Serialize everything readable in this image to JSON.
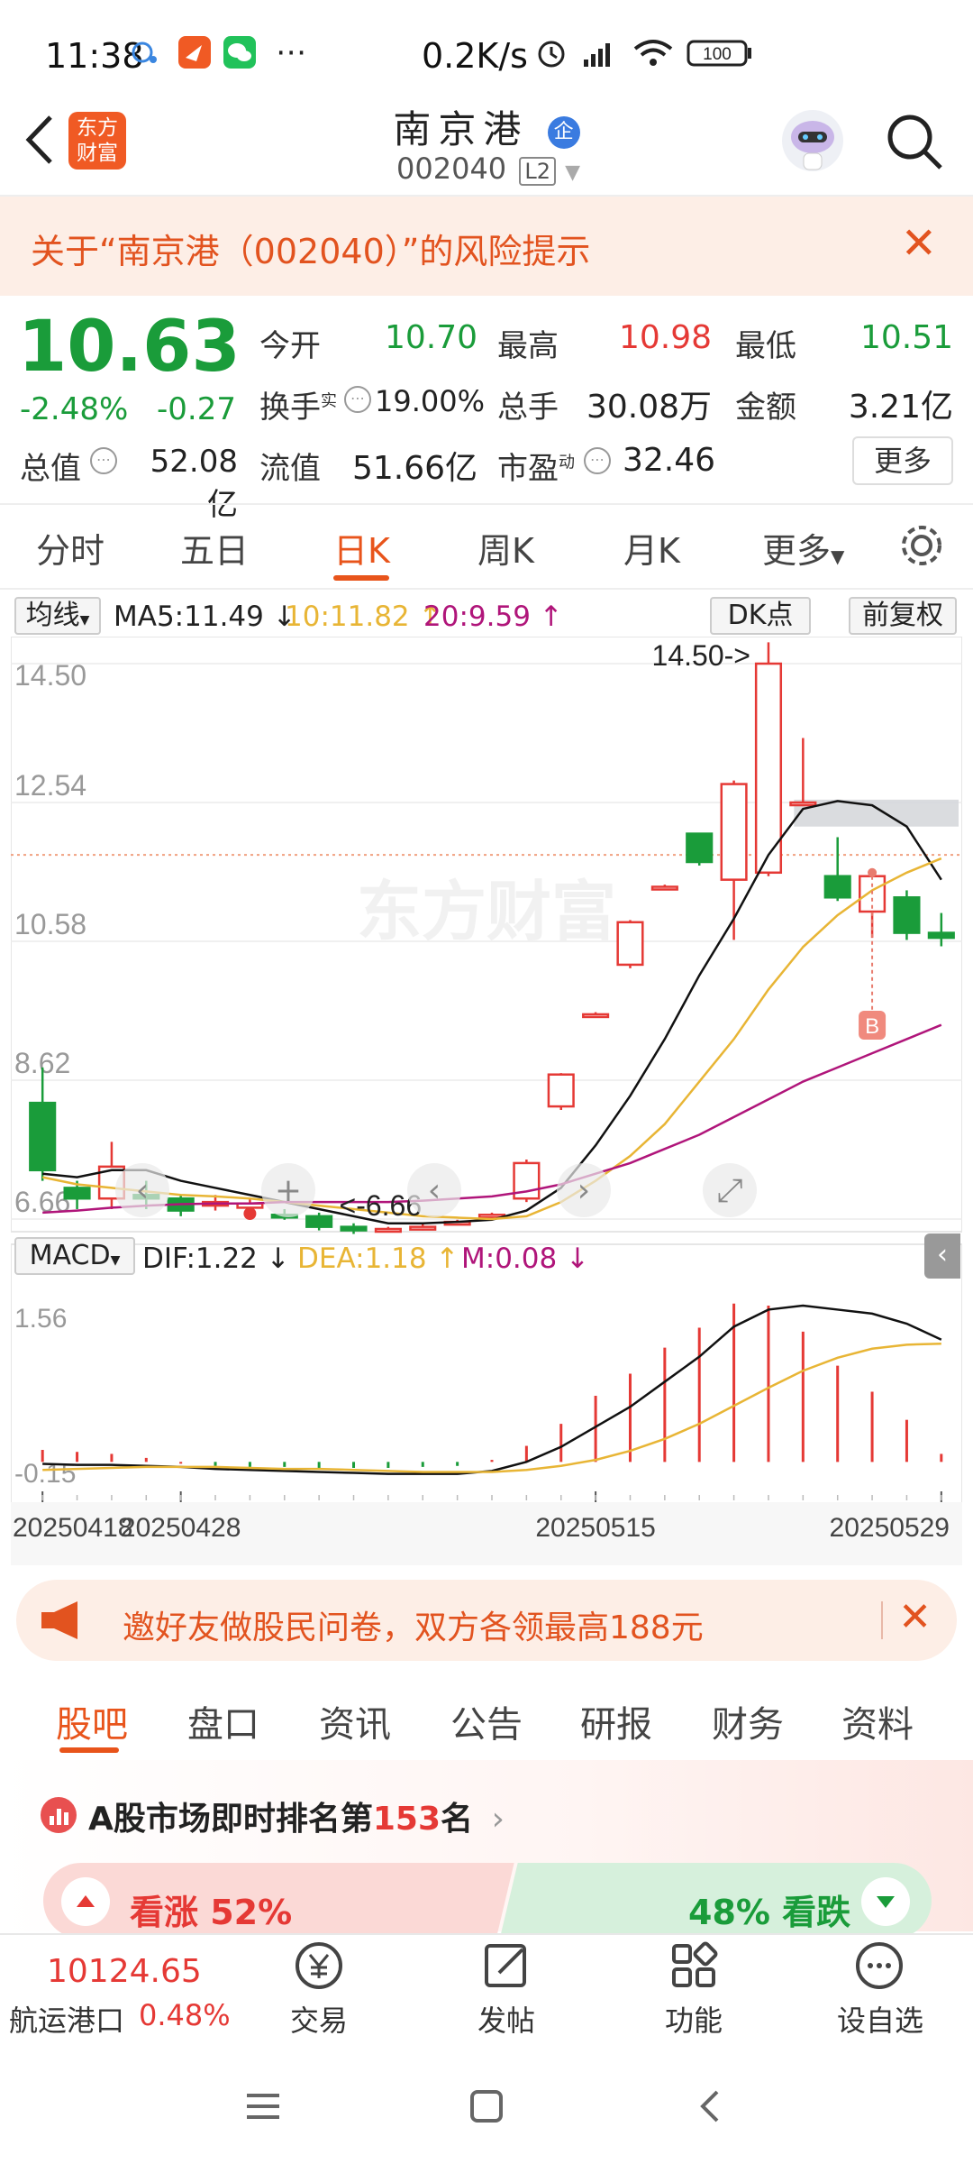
{
  "status": {
    "time": "11:38",
    "net_speed": "0.2K/s",
    "battery": "100"
  },
  "header": {
    "back_label": "<",
    "logo_text_1": "东方",
    "logo_text_2": "财富",
    "title": "南京港",
    "badge": "企",
    "code": "002040",
    "level": "L2"
  },
  "risk_banner": {
    "text": "关于“南京港（002040）”的风险提示",
    "close": "✕"
  },
  "quote": {
    "price": "10.63",
    "change_pct": "-2.48%",
    "change": "-0.27",
    "open_label": "今开",
    "open": "10.70",
    "high_label": "最高",
    "high": "10.98",
    "low_label": "最低",
    "low": "10.51",
    "turnover_label": "换手",
    "turnover_sup": "实",
    "turnover": "19.00%",
    "volume_label": "总手",
    "volume": "30.08万",
    "amount_label": "金额",
    "amount": "3.21亿",
    "mktcap_label": "总值",
    "mktcap": "52.08亿",
    "float_label": "流值",
    "float": "51.66亿",
    "pe_label": "市盈",
    "pe_sup": "动",
    "pe": "32.46",
    "more": "更多"
  },
  "tabs": [
    "分时",
    "五日",
    "日K",
    "周K",
    "月K",
    "更多"
  ],
  "indicators": {
    "ma_select": "均线",
    "ma5": "MA5:11.49",
    "ma10": "10:11.82",
    "ma20": "20:9.59",
    "dk": "DK点",
    "adjust": "前复权",
    "macd_select": "MACD",
    "dif": "DIF:1.22",
    "dea": "DEA:1.18",
    "m": "M:0.08"
  },
  "chart_data": {
    "type": "candlestick",
    "price_axis": {
      "ticks": [
        "14.50",
        "12.54",
        "10.58",
        "8.62",
        "6.66"
      ],
      "ylim": [
        6.66,
        14.5
      ]
    },
    "macd_axis": {
      "ticks": [
        "1.56",
        "-0.15"
      ],
      "ylim": [
        -0.15,
        1.56
      ]
    },
    "x_ticks": [
      "20250418",
      "20250428",
      "20250515",
      "20250529"
    ],
    "annotations": {
      "high_label": "14.50->",
      "low_label": "<-6.66",
      "buy_marker": "B"
    },
    "watermark": "东方财富",
    "candles": [
      {
        "o": 8.3,
        "c": 7.35,
        "h": 8.8,
        "l": 7.2
      },
      {
        "o": 7.1,
        "c": 6.95,
        "h": 7.2,
        "l": 6.8
      },
      {
        "o": 6.95,
        "c": 7.4,
        "h": 7.75,
        "l": 6.8
      },
      {
        "o": 7.0,
        "c": 6.95,
        "h": 7.2,
        "l": 6.8
      },
      {
        "o": 6.95,
        "c": 6.78,
        "h": 7.0,
        "l": 6.7
      },
      {
        "o": 6.85,
        "c": 6.9,
        "h": 7.0,
        "l": 6.78
      },
      {
        "o": 6.82,
        "c": 6.88,
        "h": 6.95,
        "l": 6.75
      },
      {
        "o": 6.72,
        "c": 6.7,
        "h": 6.8,
        "l": 6.65
      },
      {
        "o": 6.7,
        "c": 6.55,
        "h": 6.75,
        "l": 6.5
      },
      {
        "o": 6.55,
        "c": 6.5,
        "h": 6.6,
        "l": 6.45
      },
      {
        "o": 6.5,
        "c": 6.52,
        "h": 6.55,
        "l": 6.48
      },
      {
        "o": 6.55,
        "c": 6.55,
        "h": 6.6,
        "l": 6.5
      },
      {
        "o": 6.62,
        "c": 6.62,
        "h": 6.65,
        "l": 6.58
      },
      {
        "o": 6.7,
        "c": 6.72,
        "h": 6.75,
        "l": 6.65
      },
      {
        "o": 6.95,
        "c": 7.45,
        "h": 7.5,
        "l": 6.9
      },
      {
        "o": 8.25,
        "c": 8.7,
        "h": 8.72,
        "l": 8.2
      },
      {
        "o": 9.55,
        "c": 9.55,
        "h": 9.58,
        "l": 9.52
      },
      {
        "o": 10.25,
        "c": 10.85,
        "h": 10.88,
        "l": 10.2
      },
      {
        "o": 11.35,
        "c": 11.35,
        "h": 11.38,
        "l": 11.32
      },
      {
        "o": 12.1,
        "c": 11.7,
        "h": 12.1,
        "l": 11.65
      },
      {
        "o": 11.45,
        "c": 12.8,
        "h": 12.85,
        "l": 10.6
      },
      {
        "o": 11.55,
        "c": 14.5,
        "h": 14.8,
        "l": 11.5
      },
      {
        "o": 12.54,
        "c": 12.54,
        "h": 13.45,
        "l": 12.54
      },
      {
        "o": 11.5,
        "c": 11.2,
        "h": 12.05,
        "l": 11.15
      },
      {
        "o": 11.0,
        "c": 11.5,
        "h": 11.55,
        "l": 10.63
      },
      {
        "o": 11.2,
        "c": 10.7,
        "h": 11.3,
        "l": 10.6
      },
      {
        "o": 10.7,
        "c": 10.63,
        "h": 10.98,
        "l": 10.51
      }
    ],
    "ma_series": [
      {
        "name": "MA5",
        "color": "#111111",
        "values": [
          7.3,
          7.25,
          7.35,
          7.35,
          7.2,
          7.1,
          7.0,
          6.9,
          6.8,
          6.7,
          6.6,
          6.6,
          6.62,
          6.65,
          6.78,
          7.1,
          7.7,
          8.4,
          9.2,
          10.1,
          10.9,
          11.8,
          12.45,
          12.56,
          12.5,
          12.2,
          11.45
        ]
      },
      {
        "name": "MA10",
        "color": "#e8b535",
        "values": [
          7.25,
          7.15,
          7.1,
          7.05,
          7.0,
          6.98,
          6.95,
          6.9,
          6.85,
          6.8,
          6.75,
          6.7,
          6.68,
          6.66,
          6.7,
          6.9,
          7.2,
          7.55,
          8.0,
          8.6,
          9.2,
          9.9,
          10.5,
          10.95,
          11.3,
          11.55,
          11.75
        ]
      },
      {
        "name": "MA20",
        "color": "#b0157a",
        "values": [
          6.75,
          6.78,
          6.82,
          6.85,
          6.87,
          6.88,
          6.88,
          6.9,
          6.9,
          6.9,
          6.9,
          6.92,
          6.95,
          6.98,
          7.05,
          7.15,
          7.3,
          7.45,
          7.65,
          7.85,
          8.1,
          8.35,
          8.6,
          8.8,
          9.0,
          9.2,
          9.4
        ]
      }
    ],
    "macd": {
      "dif": [
        -0.02,
        -0.03,
        -0.03,
        -0.04,
        -0.05,
        -0.07,
        -0.08,
        -0.09,
        -0.1,
        -0.11,
        -0.12,
        -0.12,
        -0.12,
        -0.09,
        0.0,
        0.15,
        0.35,
        0.55,
        0.8,
        1.05,
        1.35,
        1.52,
        1.56,
        1.52,
        1.48,
        1.38,
        1.22
      ],
      "dea": [
        -0.08,
        -0.07,
        -0.06,
        -0.05,
        -0.05,
        -0.05,
        -0.06,
        -0.07,
        -0.07,
        -0.08,
        -0.09,
        -0.1,
        -0.1,
        -0.1,
        -0.08,
        -0.04,
        0.02,
        0.11,
        0.23,
        0.38,
        0.56,
        0.74,
        0.91,
        1.04,
        1.13,
        1.17,
        1.18
      ],
      "hist": [
        0.12,
        0.1,
        0.08,
        0.04,
        0.0,
        -0.04,
        -0.05,
        -0.05,
        -0.06,
        -0.06,
        -0.06,
        -0.05,
        -0.04,
        0.02,
        0.16,
        0.38,
        0.66,
        0.88,
        1.14,
        1.34,
        1.58,
        1.56,
        1.3,
        0.96,
        0.7,
        0.42,
        0.08
      ]
    }
  },
  "promo": {
    "text": "邀好友做股民问卷，双方各领最高188元",
    "close": "✕"
  },
  "bottom_tabs": [
    "股吧",
    "盘口",
    "资讯",
    "公告",
    "研报",
    "财务",
    "资料"
  ],
  "ranking": {
    "prefix": "A股市场即时排名第",
    "rank": "153",
    "suffix": "名",
    "up_label": "看涨 52%",
    "down_label": "48% 看跌",
    "up_pct": 52
  },
  "bottom_bar": {
    "index_value": "10124.65",
    "index_name": "航运港口",
    "index_change": "0.48%",
    "items": [
      "交易",
      "发帖",
      "功能",
      "设自选"
    ]
  },
  "colors": {
    "up": "#e53935",
    "down": "#1a9c3a",
    "accent": "#e8541b"
  }
}
